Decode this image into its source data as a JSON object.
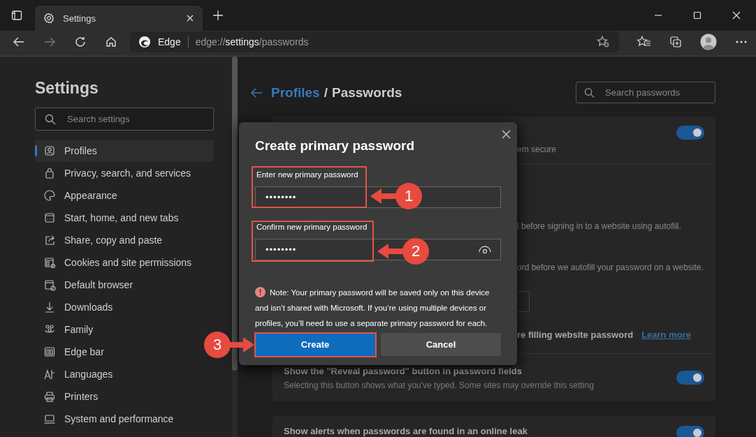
{
  "browser": {
    "tabs": [
      {
        "title": "Settings",
        "selected": true
      }
    ],
    "address": {
      "site": "Edge",
      "prefix": "edge://",
      "main": "settings",
      "suffix": "/passwords"
    }
  },
  "sidebar": {
    "title": "Settings",
    "search_placeholder": "Search settings",
    "items": [
      {
        "label": "Profiles",
        "selected": true
      },
      {
        "label": "Privacy, search, and services",
        "selected": false
      },
      {
        "label": "Appearance",
        "selected": false
      },
      {
        "label": "Start, home, and new tabs",
        "selected": false
      },
      {
        "label": "Share, copy and paste",
        "selected": false
      },
      {
        "label": "Cookies and site permissions",
        "selected": false
      },
      {
        "label": "Default browser",
        "selected": false
      },
      {
        "label": "Downloads",
        "selected": false
      },
      {
        "label": "Family",
        "selected": false
      },
      {
        "label": "Edge bar",
        "selected": false
      },
      {
        "label": "Languages",
        "selected": false
      },
      {
        "label": "Printers",
        "selected": false
      },
      {
        "label": "System and performance",
        "selected": false
      }
    ]
  },
  "page": {
    "breadcrumb_parent": "Profiles",
    "breadcrumb_separator": "/",
    "breadcrumb_current": "Passwords",
    "search_placeholder": "Search passwords"
  },
  "settings_cards": [
    {
      "rows": [
        {
          "kind": "fragment",
          "subtitle": "em secure",
          "on": true
        }
      ]
    },
    {
      "rows": [
        {
          "kind": "fragment",
          "subtitle": "l before signing in to a website using autofill."
        },
        {
          "kind": "fragment",
          "subtitle": "ord before we autofill your password on a website."
        },
        {
          "kind": "dropdown"
        },
        {
          "kind": "link",
          "title": "re filling website password",
          "link": "Learn more"
        },
        {
          "kind": "toggle",
          "title": "Show the \"Reveal password\" button in password fields",
          "subtitle": "Selecting this button shows what you've typed. Some sites may override this setting",
          "on": true
        }
      ]
    },
    {
      "rows": [
        {
          "kind": "toggle",
          "title": "Show alerts when passwords are found in an online leak",
          "on": true
        }
      ]
    }
  ],
  "dialog": {
    "title": "Create primary password",
    "fields": [
      {
        "label": "Enter new primary password",
        "value": "••••••••",
        "reveal": false
      },
      {
        "label": "Confirm new primary password",
        "value": "••••••••",
        "reveal": true
      }
    ],
    "note": "Note: Your primary password will be saved only on this device and isn’t shared with Microsoft. If you’re using multiple devices or profiles, you’ll need to use a separate primary password for each.",
    "buttons": [
      {
        "label": "Create",
        "primary": true
      },
      {
        "label": "Cancel",
        "primary": false
      }
    ]
  },
  "annotations": [
    {
      "number": "1"
    },
    {
      "number": "2"
    },
    {
      "number": "3"
    }
  ]
}
